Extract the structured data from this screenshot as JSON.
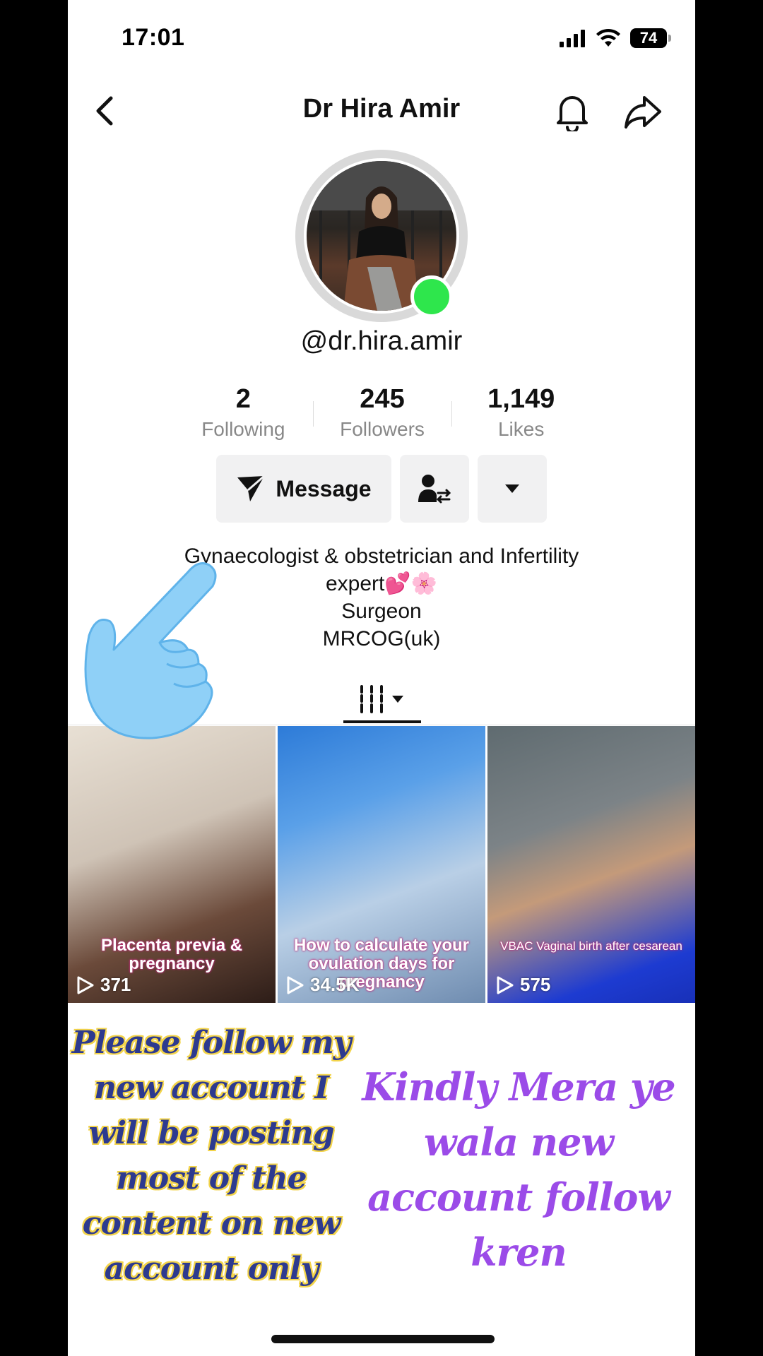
{
  "status_bar": {
    "time": "17:01",
    "battery": "74"
  },
  "header": {
    "title": "Dr Hira Amir"
  },
  "profile": {
    "username": "@dr.hira.amir"
  },
  "stats": [
    {
      "value": "2",
      "label": "Following"
    },
    {
      "value": "245",
      "label": "Followers"
    },
    {
      "value": "1,149",
      "label": "Likes"
    }
  ],
  "actions": {
    "message_label": "Message"
  },
  "bio": {
    "line1": "Gynaecologist & obstetrician and Infertility",
    "line2": "expert💕🌸",
    "line3": "Surgeon",
    "line4": "MRCOG(uk)"
  },
  "videos": [
    {
      "caption": "Placenta previa & pregnancy",
      "views": "371"
    },
    {
      "caption": "How to calculate your ovulation days for pregnancy",
      "views": "34.5K"
    },
    {
      "caption": "VBAC Vaginal birth after cesarean",
      "views": "575"
    }
  ],
  "overlay": {
    "left_text": "Please follow my new account I will be posting most of the content on new account only",
    "right_text": "Kindly Mera ye wala new account follow kren"
  },
  "colors": {
    "live": "#2ee64c",
    "promo_left": "#2d3a8f",
    "promo_left_outline": "#f3d44a",
    "promo_right": "#9b4be8"
  }
}
